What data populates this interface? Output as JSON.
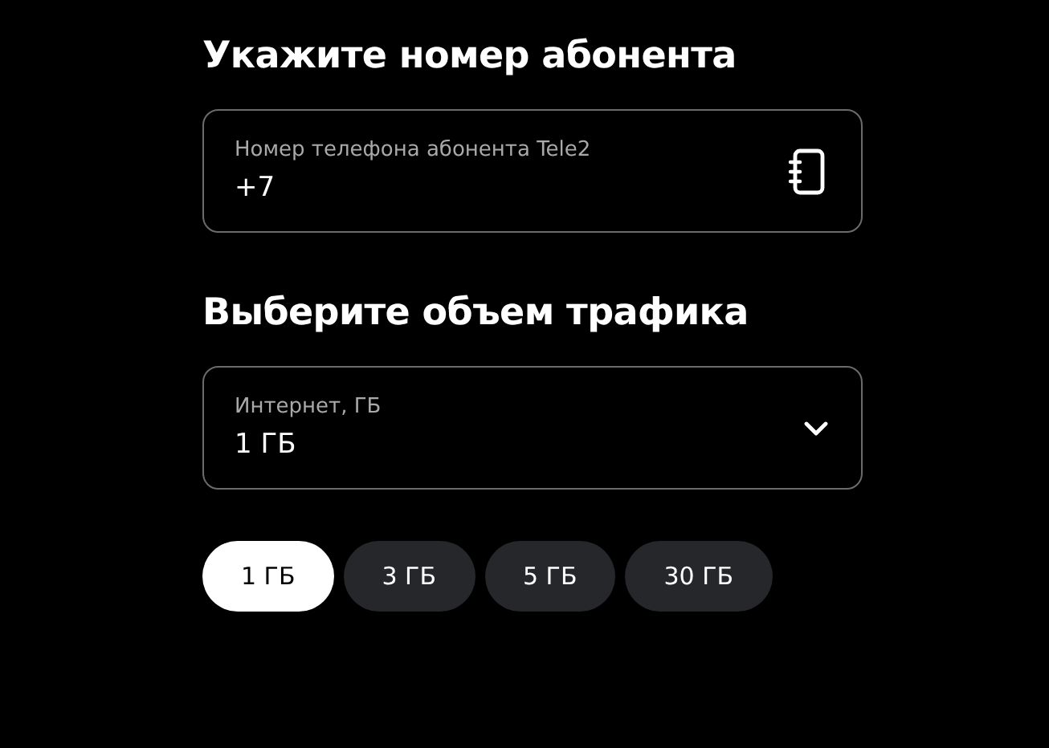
{
  "phone_section": {
    "title": "Укажите номер абонента",
    "field": {
      "label": "Номер телефона абонента Tele2",
      "value": "+7"
    }
  },
  "traffic_section": {
    "title": "Выберите объем трафика",
    "select": {
      "label": "Интернет, ГБ",
      "value": "1 ГБ"
    },
    "options": [
      {
        "label": "1 ГБ",
        "selected": true
      },
      {
        "label": "3 ГБ",
        "selected": false
      },
      {
        "label": "5 ГБ",
        "selected": false
      },
      {
        "label": "30 ГБ",
        "selected": false
      }
    ]
  }
}
